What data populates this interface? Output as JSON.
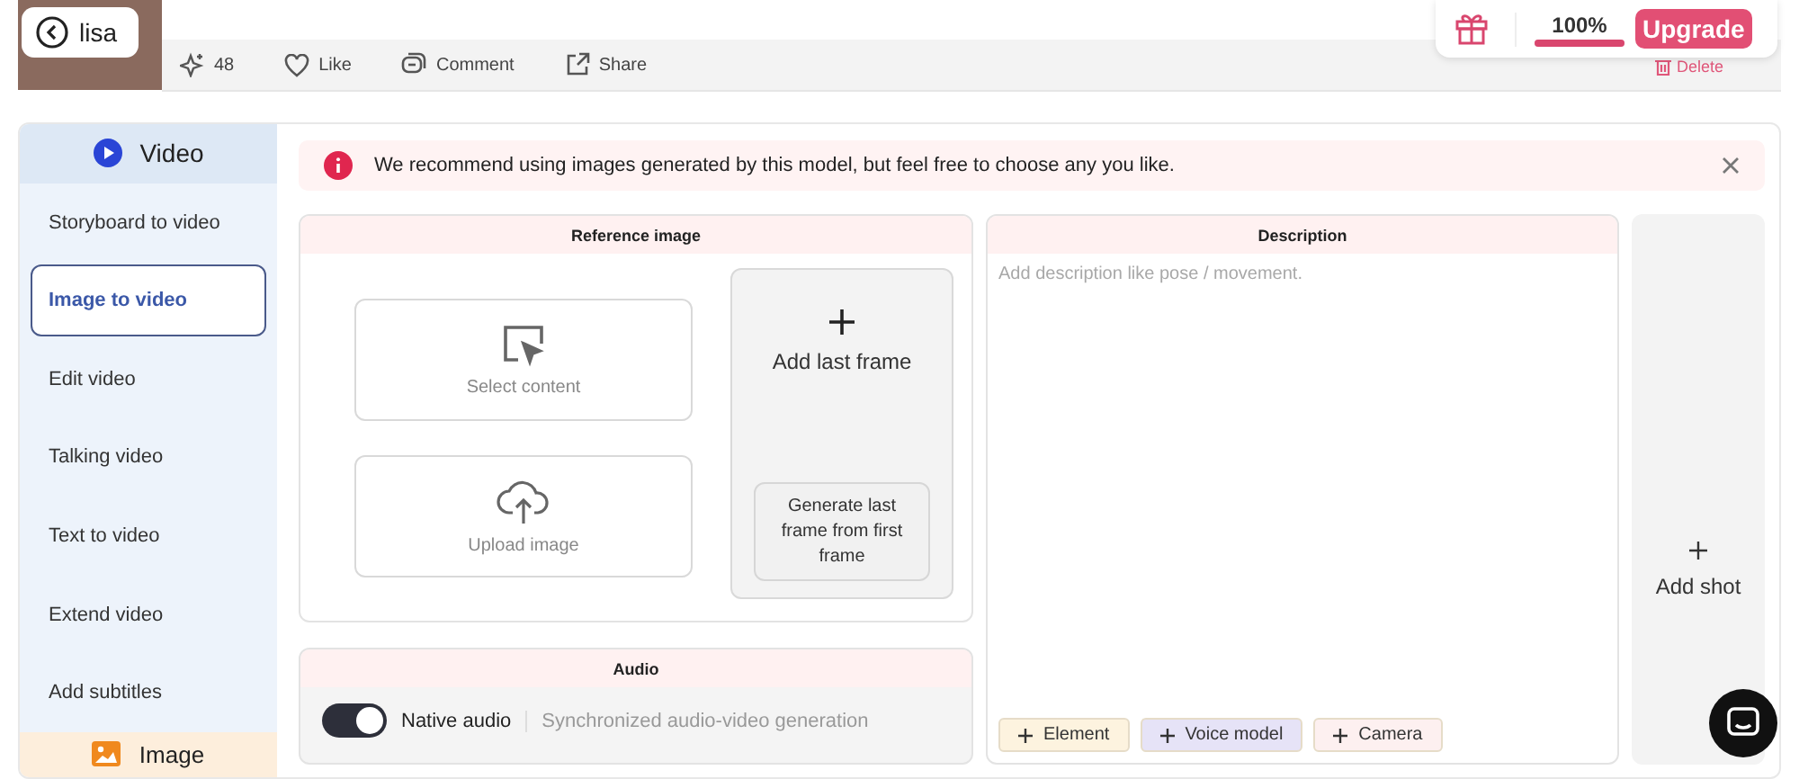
{
  "profile": {
    "back_label": "lisa"
  },
  "actions": [
    {
      "kind": "spark",
      "label": "48"
    },
    {
      "kind": "like",
      "label": "Like"
    },
    {
      "kind": "comment",
      "label": "Comment"
    },
    {
      "kind": "share",
      "label": "Share"
    }
  ],
  "delete_label": "Delete",
  "credits": {
    "percent": "100%",
    "level": 1.0,
    "upgrade": "Upgrade"
  },
  "sidebar": {
    "section": "Video",
    "items": [
      {
        "label": "Storyboard to video",
        "selected": false
      },
      {
        "label": "Image to video",
        "selected": true
      },
      {
        "label": "Edit video",
        "selected": false
      },
      {
        "label": "Talking video",
        "selected": false
      },
      {
        "label": "Text to video",
        "selected": false
      },
      {
        "label": "Extend video",
        "selected": false
      },
      {
        "label": "Add subtitles",
        "selected": false
      }
    ],
    "next_section": "Image"
  },
  "alert": "We recommend using images generated by this model, but feel free to choose any you like.",
  "reference": {
    "title": "Reference image",
    "select": "Select content",
    "upload": "Upload image",
    "add_last": "Add last frame",
    "generate": "Generate last frame from first frame"
  },
  "audio": {
    "title": "Audio",
    "toggle_label": "Native audio",
    "on": true,
    "hint": "Synchronized audio-video generation"
  },
  "description": {
    "title": "Description",
    "placeholder": "Add description like pose / movement.",
    "chips": [
      {
        "label": "Element",
        "color": "#fdf3df"
      },
      {
        "label": "Voice model",
        "color": "#e6e3f7"
      },
      {
        "label": "Camera",
        "color": "#fdf0f0"
      }
    ]
  },
  "add_shot": "Add shot"
}
